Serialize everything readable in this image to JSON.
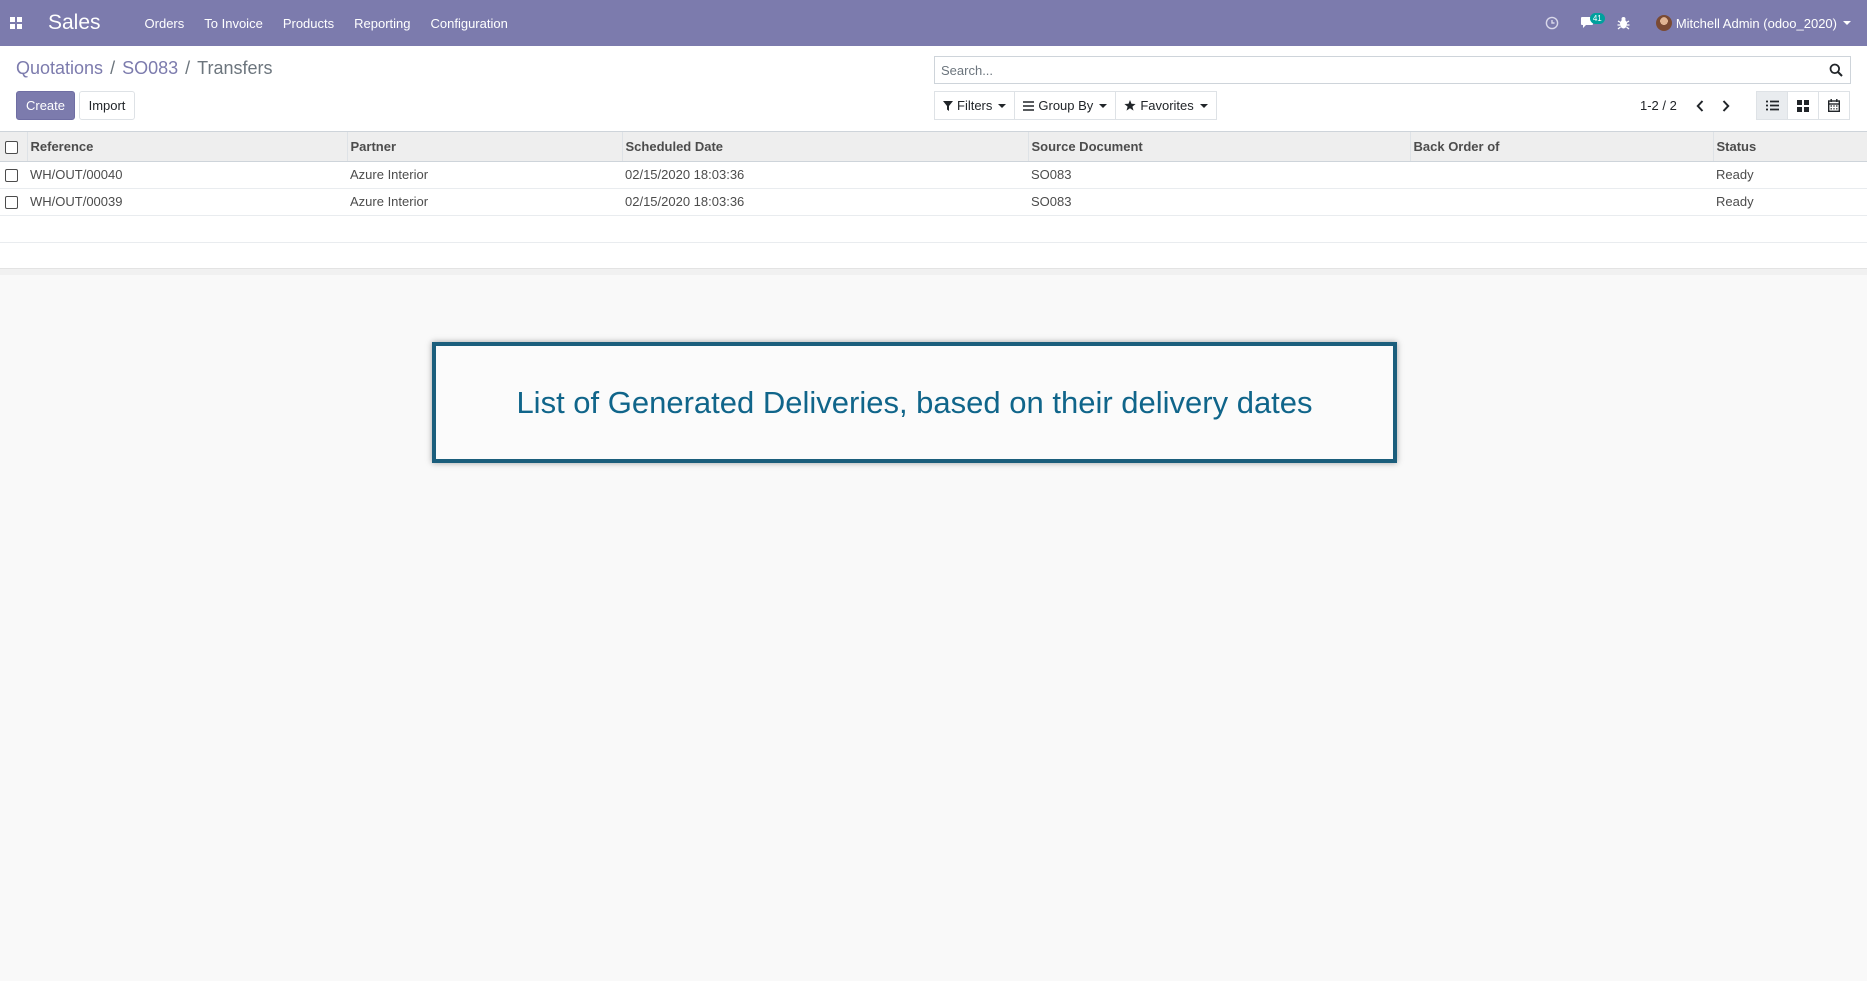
{
  "navbar": {
    "app_name": "Sales",
    "menu": [
      "Orders",
      "To Invoice",
      "Products",
      "Reporting",
      "Configuration"
    ],
    "messages_badge": "41",
    "user_name": "Mitchell Admin (odoo_2020)",
    "color": "#7c7bad"
  },
  "breadcrumb": {
    "items": [
      "Quotations",
      "SO083"
    ],
    "current": "Transfers"
  },
  "buttons": {
    "create": "Create",
    "import": "Import"
  },
  "search": {
    "placeholder": "Search..."
  },
  "filters": {
    "filters_label": "Filters",
    "group_by_label": "Group By",
    "favorites_label": "Favorites"
  },
  "pager": {
    "value": "1-2 / 2"
  },
  "table": {
    "columns": [
      "Reference",
      "Partner",
      "Scheduled Date",
      "Source Document",
      "Back Order of",
      "Status"
    ],
    "rows": [
      {
        "reference": "WH/OUT/00040",
        "partner": "Azure Interior",
        "scheduled_date": "02/15/2020 18:03:36",
        "source_document": "SO083",
        "back_order_of": "",
        "status": "Ready"
      },
      {
        "reference": "WH/OUT/00039",
        "partner": "Azure Interior",
        "scheduled_date": "02/15/2020 18:03:36",
        "source_document": "SO083",
        "back_order_of": "",
        "status": "Ready"
      }
    ]
  },
  "annotation": {
    "text": "List of Generated Deliveries, based on their delivery dates",
    "border_color": "#1b5e7c",
    "text_color": "#10658a"
  }
}
